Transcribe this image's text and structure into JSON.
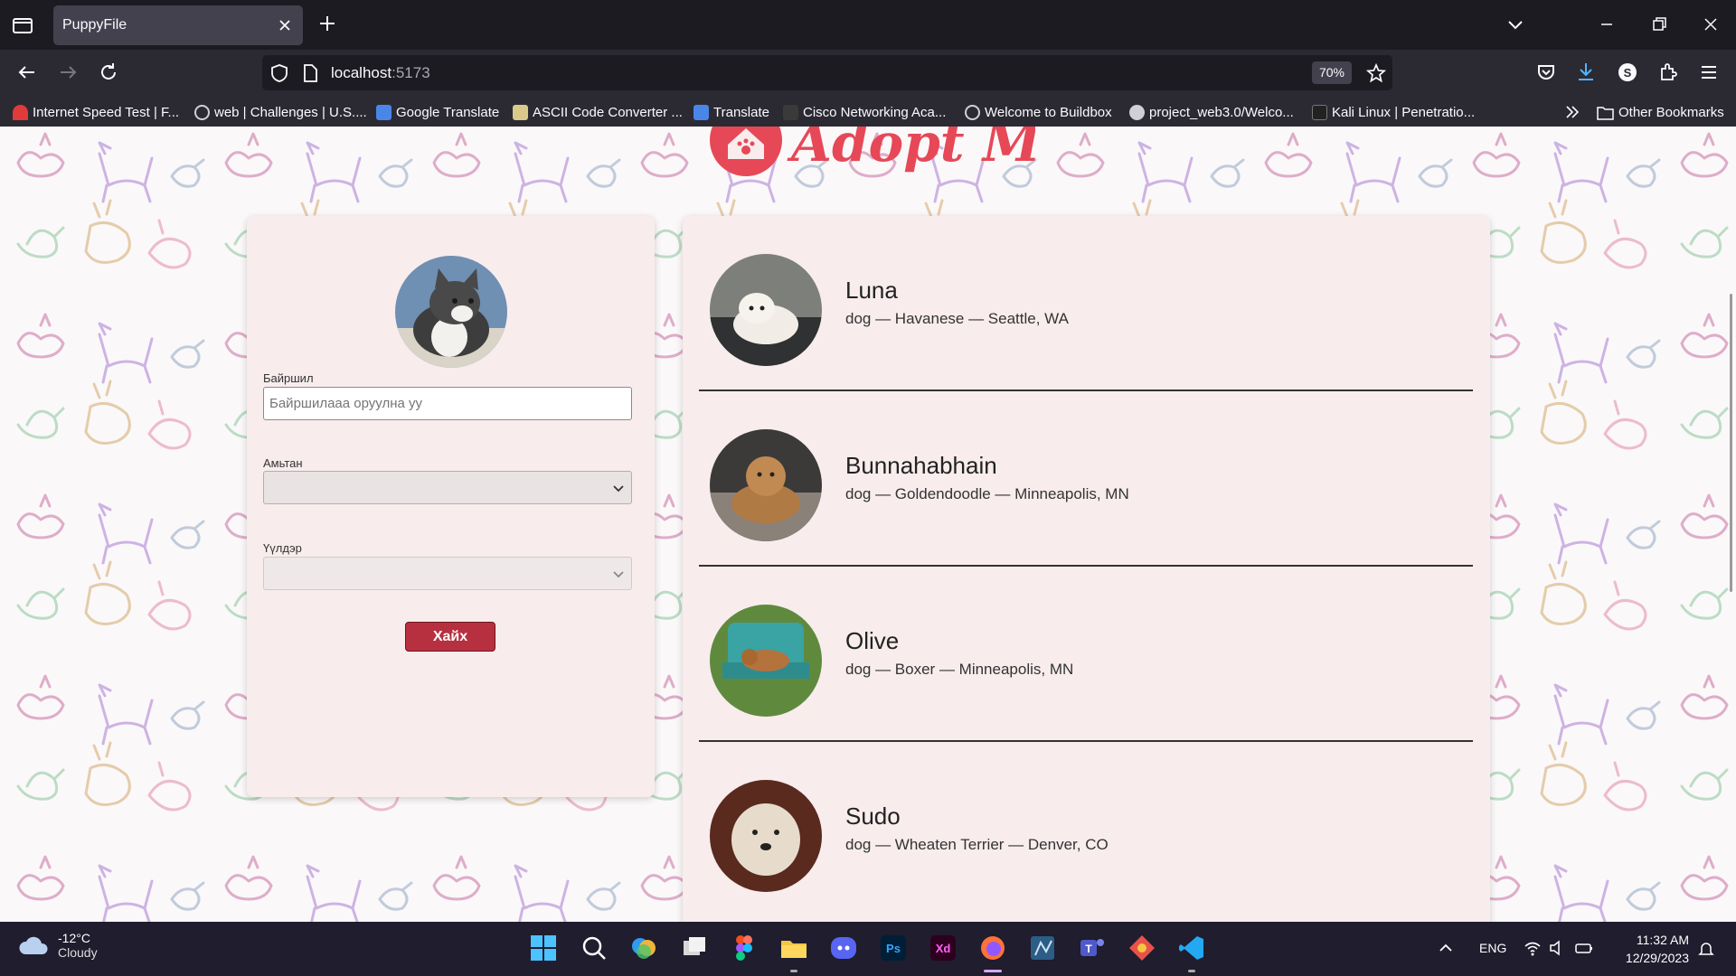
{
  "browser": {
    "tab_title": "PuppyFile",
    "url_host": "localhost",
    "url_port": ":5173",
    "zoom": "70%",
    "bookmarks": [
      {
        "label": "Internet Speed Test | F...",
        "color": "#e03a3a"
      },
      {
        "label": "web | Challenges | U.S....",
        "color": "#cfcfd8"
      },
      {
        "label": "Google Translate",
        "color": "#4a86e8"
      },
      {
        "label": "ASCII Code Converter ...",
        "color": "#d9c98a"
      },
      {
        "label": "Translate",
        "color": "#4a86e8"
      },
      {
        "label": "Cisco Networking Aca...",
        "color": "#3a3a3a"
      },
      {
        "label": "Welcome to Buildbox",
        "color": "#cfcfd8"
      },
      {
        "label": "project_web3.0/Welco...",
        "color": "#cfcfd8"
      },
      {
        "label": "Kali Linux | Penetratio...",
        "color": "#222"
      }
    ],
    "other_bookmarks": "Other Bookmarks"
  },
  "search_form": {
    "location_label": "Байршил",
    "location_placeholder": "Байршилаaa оруулна уу",
    "animal_label": "Амьтан",
    "animal_value": "",
    "breed_label": "Үүлдэр",
    "breed_value": "",
    "submit_label": "Хайх"
  },
  "pets": [
    {
      "name": "Luna",
      "meta": "dog — Havanese — Seattle, WA"
    },
    {
      "name": "Bunnahabhain",
      "meta": "dog — Goldendoodle — Minneapolis, MN"
    },
    {
      "name": "Olive",
      "meta": "dog — Boxer — Minneapolis, MN"
    },
    {
      "name": "Sudo",
      "meta": "dog — Wheaten Terrier — Denver, CO"
    }
  ],
  "taskbar": {
    "temperature": "-12°C",
    "weather": "Cloudy",
    "language": "ENG",
    "time": "11:32 AM",
    "date": "12/29/2023"
  },
  "colors": {
    "accent": "#b7303f",
    "logo": "#e64857",
    "card": "#f8eced"
  }
}
